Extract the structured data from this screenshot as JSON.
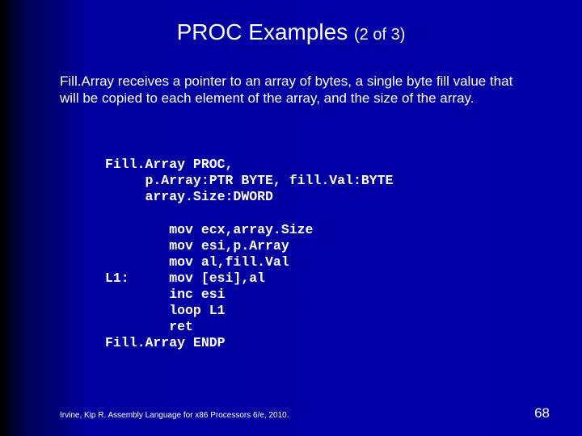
{
  "title": {
    "main": "PROC Examples",
    "sub": "(2 of 3)"
  },
  "description": "Fill.Array receives a pointer to an array of bytes, a single byte fill value that will be copied to each element of the array, and the size of the array.",
  "code": "Fill.Array PROC,\n     p.Array:PTR BYTE, fill.Val:BYTE\n     array.Size:DWORD\n\n        mov ecx,array.Size\n        mov esi,p.Array\n        mov al,fill.Val\nL1:     mov [esi],al\n        inc esi\n        loop L1\n        ret\nFill.Array ENDP",
  "footer": "Irvine, Kip R. Assembly Language for x86 Processors 6/e, 2010.",
  "page": "68"
}
